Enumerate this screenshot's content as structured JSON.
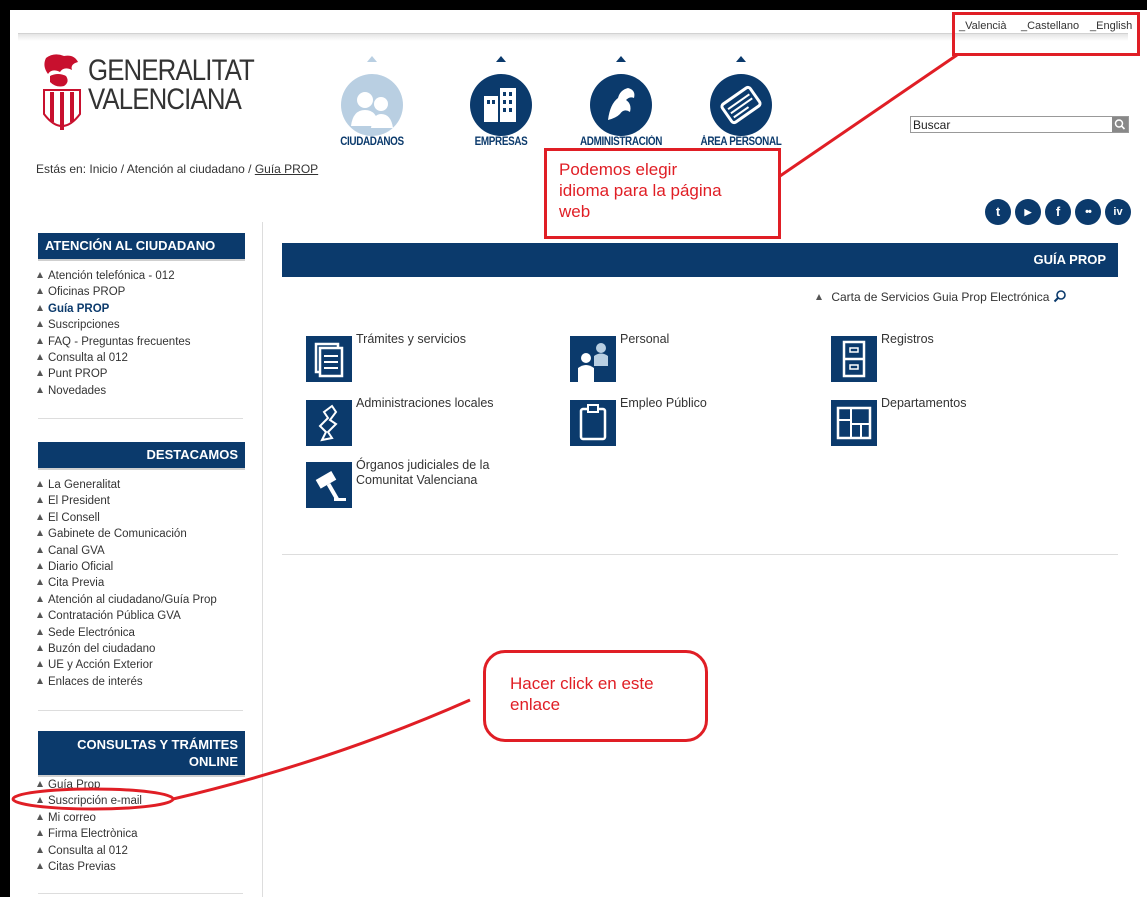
{
  "languages": [
    "_Valencià",
    "_Castellano",
    "_English"
  ],
  "logo": {
    "line1": "GENERALITAT",
    "line2": "VALENCIANA"
  },
  "nav": [
    {
      "label": "CIUDADANOS",
      "icon": "citizens-icon"
    },
    {
      "label": "EMPRESAS",
      "icon": "buildings-icon"
    },
    {
      "label": "ADMINISTRACIÓN",
      "icon": "horse-emblem-icon"
    },
    {
      "label": "ÁREA PERSONAL",
      "icon": "personal-card-icon"
    }
  ],
  "search": {
    "value": "Buscar"
  },
  "breadcrumb": {
    "prefix": "Estás en: Inicio / Atención al ciudadano / ",
    "current": "Guía PROP"
  },
  "social": [
    {
      "icon": "twitter-icon",
      "glyph": "t"
    },
    {
      "icon": "youtube-icon",
      "glyph": "▶"
    },
    {
      "icon": "facebook-icon",
      "glyph": "f"
    },
    {
      "icon": "flickr-icon",
      "glyph": "••"
    },
    {
      "icon": "ivoox-icon",
      "glyph": "iv"
    }
  ],
  "sidebar": {
    "sections": [
      {
        "title": "ATENCIÓN AL CIUDADANO",
        "items": [
          "Atención telefónica - 012",
          "Oficinas PROP",
          "Guía PROP",
          "Suscripciones",
          "FAQ - Preguntas frecuentes",
          "Consulta al 012",
          "Punt PROP",
          "Novedades"
        ]
      },
      {
        "title": "DESTACAMOS",
        "items": [
          "La Generalitat",
          "El President",
          "El Consell",
          "Gabinete de Comunicación",
          "Canal GVA",
          "Diario Oficial",
          "Cita Previa",
          "Atención al ciudadano/Guía Prop",
          "Contratación Pública GVA",
          "Sede Electrónica",
          "Buzón del ciudadano",
          "UE y Acción Exterior",
          "Enlaces de interés"
        ]
      },
      {
        "title": "CONSULTAS Y TRÁMITES ONLINE",
        "items": [
          "Guía Prop",
          "Suscripción e-mail",
          "Mi correo",
          "Firma Electrònica",
          "Consulta al 012",
          "Citas Previas"
        ]
      }
    ]
  },
  "main": {
    "bar_title": "GUÍA PROP",
    "carta_link": "Carta de Servicios Guia Prop Electrónica",
    "tiles": [
      {
        "label": "Trámites y servicios",
        "icon": "documents-icon"
      },
      {
        "label": "Personal",
        "icon": "staff-icon"
      },
      {
        "label": "Registros",
        "icon": "filing-cabinet-icon"
      },
      {
        "label": "Administraciones locales",
        "icon": "region-map-icon"
      },
      {
        "label": "Empleo Público",
        "icon": "clipboard-icon"
      },
      {
        "label": "Departamentos",
        "icon": "floor-plan-icon"
      },
      {
        "label": "Órganos judiciales de la",
        "label2": "Comunitat Valenciana",
        "icon": "gavel-icon"
      }
    ]
  },
  "annotations": {
    "language_note": [
      "Podemos elegir",
      "idioma para la página",
      "web"
    ],
    "click_note": [
      "Hacer click en este",
      "enlace"
    ]
  },
  "colors": {
    "primary": "#0b3a6c",
    "annotation": "#e01e25"
  }
}
